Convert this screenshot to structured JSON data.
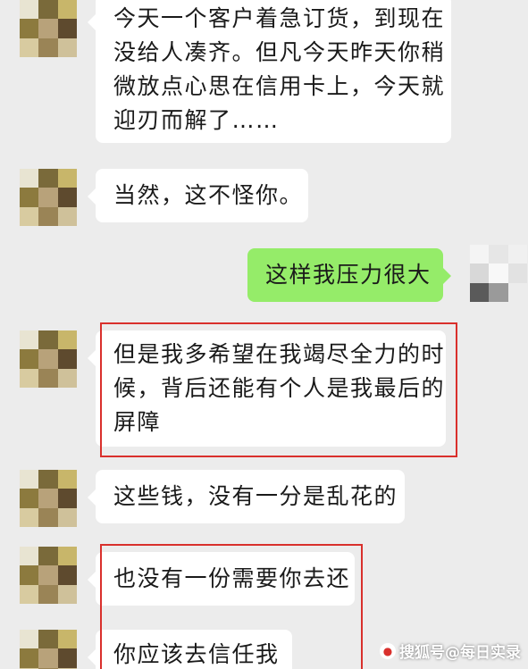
{
  "messages": [
    {
      "side": "left",
      "lines": [
        "今天一个客户着急订货，到现在",
        "没给人凑齐。但凡今天昨天你稍",
        "微放点心思在信用卡上，今天就",
        "迎刃而解了……"
      ]
    },
    {
      "side": "left",
      "lines": [
        "当然，这不怪你。"
      ]
    },
    {
      "side": "right",
      "lines": [
        "这样我压力很大"
      ]
    },
    {
      "side": "left",
      "lines": [
        "但是我多希望在我竭尽全力的时",
        "候，背后还能有个人是我最后的",
        "屏障"
      ],
      "highlighted": true
    },
    {
      "side": "left",
      "lines": [
        "这些钱，没有一分是乱花的"
      ]
    },
    {
      "side": "left",
      "lines": [
        "也没有一份需要你去还"
      ],
      "highlighted": true
    },
    {
      "side": "left",
      "lines": [
        "你应该去信任我"
      ],
      "highlighted": true
    }
  ],
  "watermark": {
    "text": "搜狐号@每日实录"
  },
  "colors": {
    "background": "#ececec",
    "left_bubble": "#ffffff",
    "right_bubble": "#95ec69",
    "highlight_border": "#d9302c"
  },
  "avatar_palettes": {
    "contact": [
      "#e8e4d2",
      "#7a6a3a",
      "#c8b66a",
      "#8c7a3e",
      "#b8a27a",
      "#5e4a2e",
      "#d8cba0",
      "#9a8456",
      "#cfc19a"
    ],
    "self": [
      "#f4f4f4",
      "#e6e6e6",
      "#f0f0f0",
      "#d8d8d8",
      "#f8f8f8",
      "#e2e2e2",
      "#5a5a5a",
      "#9a9a9a",
      "#ececec"
    ]
  }
}
